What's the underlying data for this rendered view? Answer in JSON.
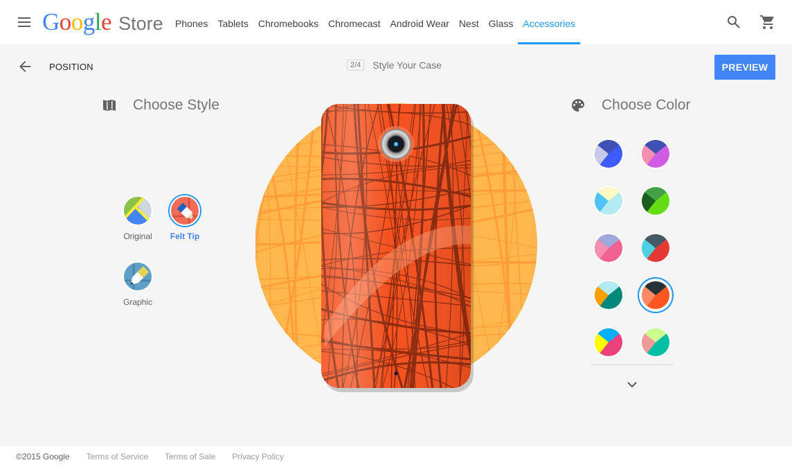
{
  "header": {
    "logo_google": [
      "G",
      "o",
      "o",
      "g",
      "l",
      "e"
    ],
    "logo_colors": [
      "#4285f4",
      "#ea4335",
      "#fbbc05",
      "#4285f4",
      "#34a853",
      "#ea4335"
    ],
    "logo_store": "Store",
    "nav": [
      {
        "label": "Phones",
        "active": false
      },
      {
        "label": "Tablets",
        "active": false
      },
      {
        "label": "Chromebooks",
        "active": false
      },
      {
        "label": "Chromecast",
        "active": false
      },
      {
        "label": "Android Wear",
        "active": false
      },
      {
        "label": "Nest",
        "active": false
      },
      {
        "label": "Glass",
        "active": false
      },
      {
        "label": "Accessories",
        "active": true
      }
    ],
    "icons": {
      "menu": "menu-icon",
      "search": "search-icon",
      "cart": "shopping-cart-icon"
    }
  },
  "subheader": {
    "back_label": "POSITION",
    "step_badge": "2/4",
    "step_title": "Style Your Case",
    "preview_label": "PREVIEW"
  },
  "style_panel": {
    "title": "Choose Style",
    "icon": "map-icon",
    "options": [
      {
        "label": "Original",
        "selected": false
      },
      {
        "label": "Felt Tip",
        "selected": true
      },
      {
        "label": "Graphic",
        "selected": false
      }
    ]
  },
  "color_panel": {
    "title": "Choose Color",
    "icon": "palette-icon",
    "swatches": [
      {
        "top": "#3f51b5",
        "left": "#c5cae9",
        "right": "#3d5afe",
        "selected": false
      },
      {
        "top": "#3f51b5",
        "left": "#f48fb1",
        "right": "#d05ce3",
        "selected": false
      },
      {
        "top": "#fff9c4",
        "left": "#4fc3f7",
        "right": "#b2ebf2",
        "selected": false
      },
      {
        "top": "#43a047",
        "left": "#1b5e20",
        "right": "#64dd17",
        "selected": false
      },
      {
        "top": "#9fa8da",
        "left": "#f48fb1",
        "right": "#f06292",
        "selected": false
      },
      {
        "top": "#455a64",
        "left": "#4dd0e1",
        "right": "#e53935",
        "selected": false
      },
      {
        "top": "#b2ebf2",
        "left": "#ffa000",
        "right": "#00897b",
        "selected": false
      },
      {
        "top": "#263238",
        "left": "#ff8a65",
        "right": "#ff5722",
        "selected": true
      },
      {
        "top": "#00b0ff",
        "left": "#ffff00",
        "right": "#ec407a",
        "selected": false
      },
      {
        "top": "#ccff90",
        "left": "#ef9a9a",
        "right": "#00bfa5",
        "selected": false
      }
    ],
    "more_icon": "chevron-down-icon"
  },
  "preview": {
    "backdrop_color": "#ffb74d",
    "case_color": "#f4511e",
    "street_color": "#8d2a0e"
  },
  "footer": {
    "copyright": "©2015 Google",
    "links": [
      "Terms of Service",
      "Terms of Sale",
      "Privacy Policy"
    ]
  }
}
